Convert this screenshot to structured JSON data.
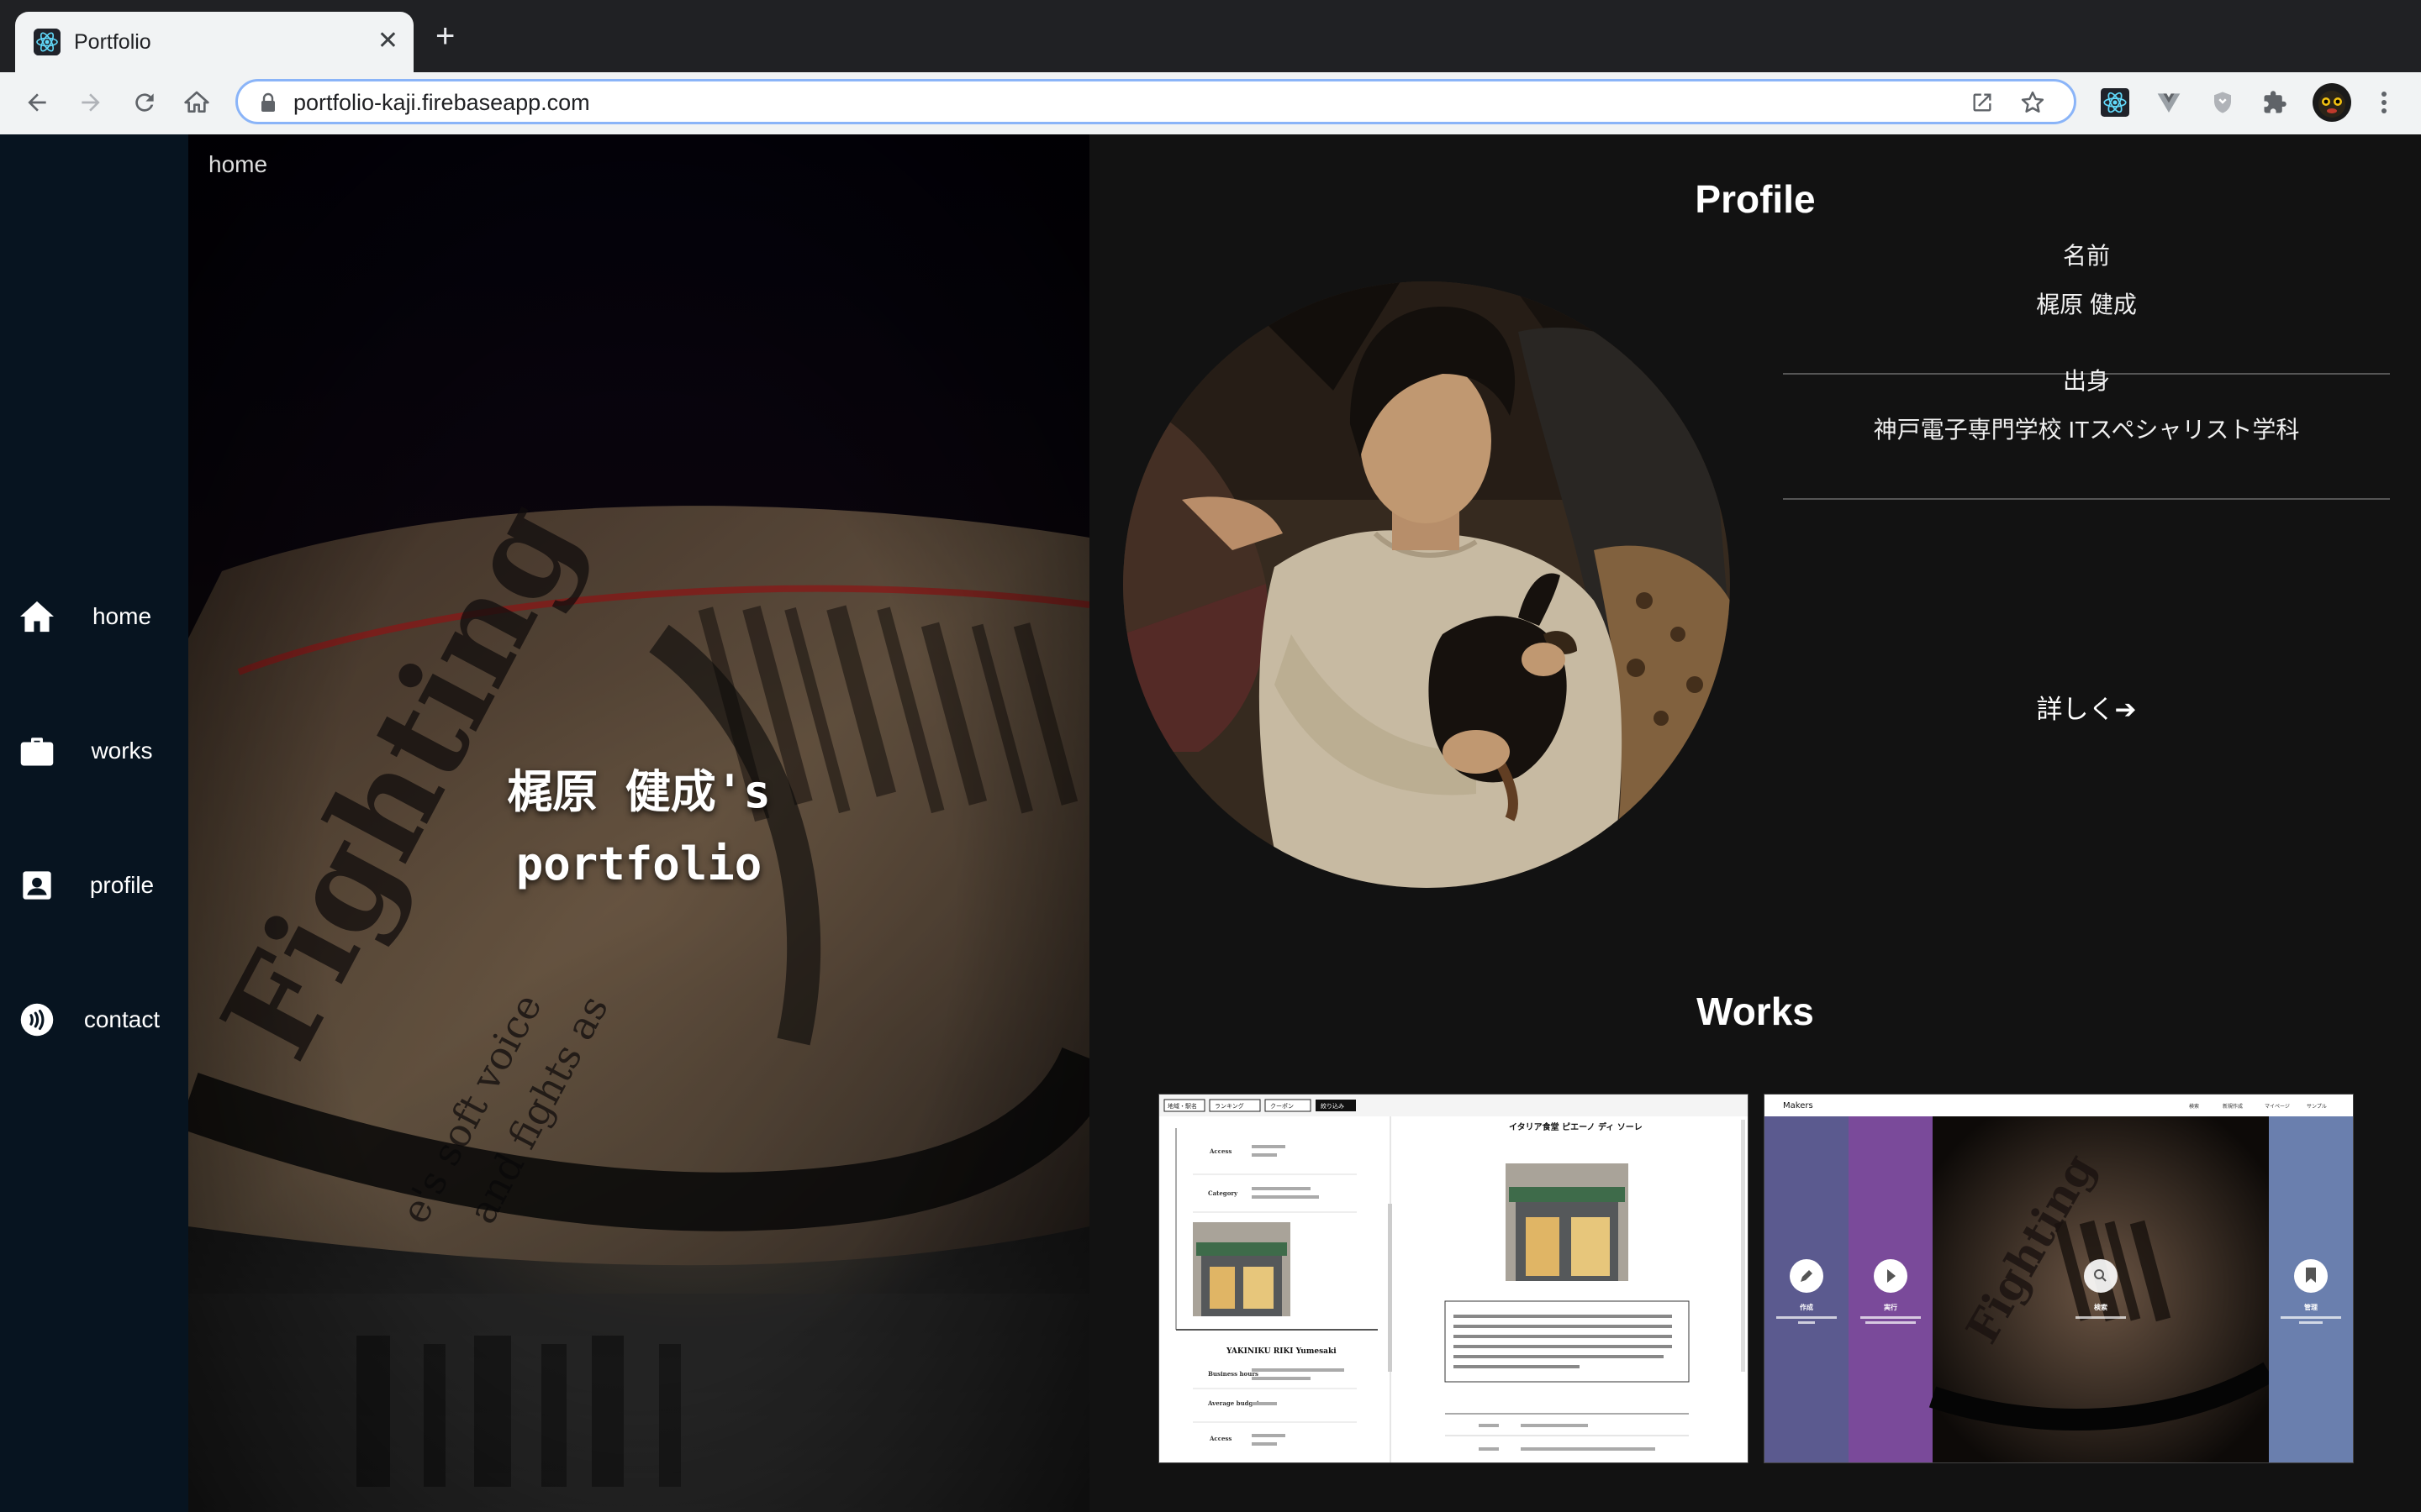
{
  "browser": {
    "tab_title": "Portfolio",
    "tab_close": "✕",
    "new_tab": "+",
    "url": "portfolio-kaji.firebaseapp.com"
  },
  "sidebar": {
    "items": [
      {
        "label": "home",
        "icon": "home-icon"
      },
      {
        "label": "works",
        "icon": "briefcase-icon"
      },
      {
        "label": "profile",
        "icon": "contact-card-icon"
      },
      {
        "label": "contact",
        "icon": "contactless-icon"
      }
    ]
  },
  "hero": {
    "breadcrumb": "home",
    "title_line1": "梶原 健成's",
    "title_line2": "portfolio"
  },
  "profile": {
    "title": "Profile",
    "name_label": "名前",
    "name_value": "梶原 健成",
    "origin_label": "出身",
    "origin_value": "神戸電子専門学校 ITスペシャリスト学科",
    "more_label": "詳しく➔"
  },
  "works": {
    "title": "Works",
    "card1": {
      "left_heading": "YAKINIKU RIKI Yumesaki",
      "right_heading": "イタリア食堂 ピエーノ ディ ソーレ",
      "labels": [
        "Access",
        "Category",
        "Business hours",
        "Average budget",
        "Access"
      ],
      "tabs": [
        "地域・駅名",
        "ランキング",
        "クーポン",
        "絞り込み"
      ]
    },
    "card2": {
      "brand": "Makers",
      "menu": [
        "検索",
        "新規作成",
        "マイページ",
        "サンプル"
      ],
      "panels": [
        "作成",
        "実行",
        "検索",
        "管理"
      ]
    }
  },
  "colors": {
    "sidebar_bg": "#071420",
    "right_bg": "#121212",
    "omnibox_focus": "#8ab4f8",
    "panel_blue": "#5b5a8f",
    "panel_purple": "#7a4a9a",
    "panel_grayblue": "#6a7fae"
  }
}
